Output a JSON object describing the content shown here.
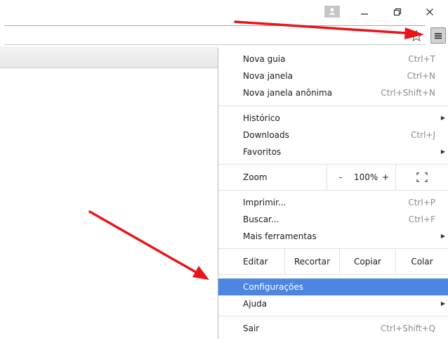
{
  "menu": {
    "group1": [
      {
        "label": "Nova guia",
        "shortcut": "Ctrl+T"
      },
      {
        "label": "Nova janela",
        "shortcut": "Ctrl+N"
      },
      {
        "label": "Nova janela anônima",
        "shortcut": "Ctrl+Shift+N"
      }
    ],
    "group2": [
      {
        "label": "Histórico",
        "shortcut": ""
      },
      {
        "label": "Downloads",
        "shortcut": "Ctrl+J"
      },
      {
        "label": "Favoritos",
        "shortcut": ""
      }
    ],
    "zoom": {
      "label": "Zoom",
      "minus": "-",
      "level": "100%",
      "plus": "+"
    },
    "group3": [
      {
        "label": "Imprimir...",
        "shortcut": "Ctrl+P"
      },
      {
        "label": "Buscar...",
        "shortcut": "Ctrl+F"
      },
      {
        "label": "Mais ferramentas",
        "shortcut": ""
      }
    ],
    "edit": {
      "label": "Editar",
      "cut": "Recortar",
      "copy": "Copiar",
      "paste": "Colar"
    },
    "group4": [
      {
        "label": "Configurações",
        "shortcut": ""
      },
      {
        "label": "Ajuda",
        "shortcut": ""
      }
    ],
    "exit": {
      "label": "Sair",
      "shortcut": "Ctrl+Shift+Q"
    },
    "highlighted_color": "#4c86e2"
  },
  "annotation_color": "#e8141b"
}
